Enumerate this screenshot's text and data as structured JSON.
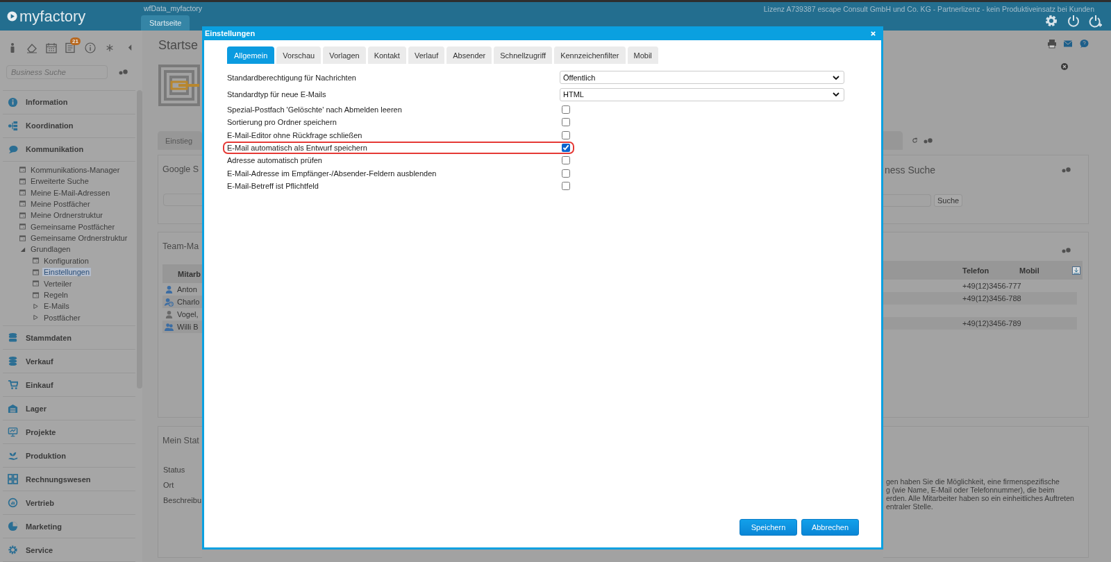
{
  "app": {
    "logo": "myfactory",
    "database": "wfData_myfactory",
    "license": "Lizenz A739387 escape Consult GmbH und Co. KG - Partnerlizenz - kein Produktiveinsatz bei Kunden",
    "tabs": [
      {
        "label": "Startseite",
        "selected": true
      }
    ]
  },
  "sidebar": {
    "notification_badge": "21",
    "search": {
      "placeholder": "Business Suche"
    },
    "sections": [
      {
        "label": "Information"
      },
      {
        "label": "Koordination"
      },
      {
        "label": "Kommunikation",
        "children": [
          {
            "label": "Kommunikations-Manager",
            "selected": false
          },
          {
            "label": "Erweiterte Suche",
            "selected": false
          },
          {
            "label": "Meine E-Mail-Adressen",
            "selected": false
          },
          {
            "label": "Meine Postfächer",
            "selected": false
          },
          {
            "label": "Meine Ordnerstruktur",
            "selected": false
          },
          {
            "label": "Gemeinsame Postfächer",
            "selected": false
          },
          {
            "label": "Gemeinsame Ordnerstruktur",
            "selected": false
          },
          {
            "label": "Grundlagen",
            "selected": false,
            "expanded": true,
            "children": [
              {
                "label": "Konfiguration",
                "selected": false
              },
              {
                "label": "Einstellungen",
                "selected": true
              },
              {
                "label": "Verteiler",
                "selected": false
              },
              {
                "label": "Regeln",
                "selected": false
              },
              {
                "label": "E-Mails",
                "selected": false,
                "expanded": false
              },
              {
                "label": "Postfächer",
                "selected": false,
                "expanded": false
              }
            ]
          }
        ]
      },
      {
        "label": "Stammdaten"
      },
      {
        "label": "Verkauf"
      },
      {
        "label": "Einkauf"
      },
      {
        "label": "Lager"
      },
      {
        "label": "Projekte"
      },
      {
        "label": "Produktion"
      },
      {
        "label": "Rechnungswesen"
      },
      {
        "label": "Vertrieb"
      },
      {
        "label": "Marketing"
      },
      {
        "label": "Service"
      }
    ]
  },
  "page": {
    "title": "Startse",
    "tabs": [
      {
        "label": "Einstieg"
      }
    ],
    "google_panel": {
      "title": "Google S"
    },
    "business_panel": {
      "title": "ness Suche",
      "button": "Suche"
    },
    "team_panel": {
      "title": "Team-Ma",
      "columns": [
        "Mitarb",
        "Telefon",
        "Mobil"
      ],
      "rows": [
        {
          "kind": "user",
          "name": "Anton",
          "phone": "+49(12)3456-777"
        },
        {
          "kind": "user_away",
          "name": "Charlo",
          "phone": "+49(12)3456-788"
        },
        {
          "kind": "user_inactive",
          "name": "Vogel,"
        },
        {
          "kind": "user_group",
          "name": "Willi B",
          "phone": "+49(12)3456-789"
        }
      ]
    },
    "status_panel": {
      "title": "Mein Stat",
      "fields": [
        "Status",
        "Ort",
        "Beschreibu"
      ],
      "text_lines": [
        "gen haben Sie die Möglichkeit, eine firmenspezifische",
        "g (wie Name, E-Mail oder Telefonnummer), die beim",
        "erden. Alle Mitarbeiter haben so ein einheitliches Auftreten",
        "entraler Stelle."
      ]
    }
  },
  "dialog": {
    "title": "Einstellungen",
    "tabs": [
      {
        "label": "Allgemein",
        "selected": true
      },
      {
        "label": "Vorschau",
        "selected": false
      },
      {
        "label": "Vorlagen",
        "selected": false
      },
      {
        "label": "Kontakt",
        "selected": false
      },
      {
        "label": "Verlauf",
        "selected": false
      },
      {
        "label": "Absender",
        "selected": false
      },
      {
        "label": "Schnellzugriff",
        "selected": false
      },
      {
        "label": "Kennzeichenfilter",
        "selected": false
      },
      {
        "label": "Mobil",
        "selected": false
      }
    ],
    "settings": [
      {
        "kind": "select",
        "label": "Standardberechtigung für Nachrichten",
        "value": "Öffentlich"
      },
      {
        "kind": "select",
        "label": "Standardtyp für neue E-Mails",
        "value": "HTML"
      },
      {
        "kind": "checkbox",
        "label": "Spezial-Postfach 'Gelöschte' nach Abmelden leeren",
        "checked": false,
        "highlighted": false
      },
      {
        "kind": "checkbox",
        "label": "Sortierung pro Ordner speichern",
        "checked": false,
        "highlighted": false
      },
      {
        "kind": "checkbox",
        "label": "E-Mail-Editor ohne Rückfrage schließen",
        "checked": false,
        "highlighted": false
      },
      {
        "kind": "checkbox",
        "label": "E-Mail automatisch als Entwurf speichern",
        "checked": true,
        "highlighted": true
      },
      {
        "kind": "checkbox",
        "label": "Adresse automatisch prüfen",
        "checked": false,
        "highlighted": false
      },
      {
        "kind": "checkbox",
        "label": "E-Mail-Adresse im Empfänger-/Absender-Feldern ausblenden",
        "checked": false,
        "highlighted": false
      },
      {
        "kind": "checkbox",
        "label": "E-Mail-Betreff ist Pflichtfeld",
        "checked": false,
        "highlighted": false
      }
    ],
    "buttons": [
      "Speichern",
      "Abbrechen"
    ]
  }
}
